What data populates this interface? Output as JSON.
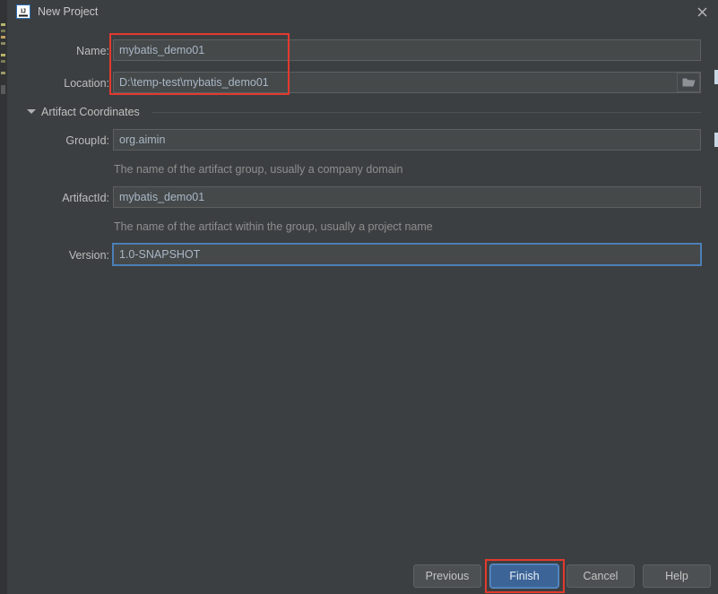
{
  "window": {
    "title": "New Project",
    "app_icon": "intellij-idea-icon",
    "close_icon": "close-icon"
  },
  "form": {
    "name": {
      "label": "Name:",
      "value": "mybatis_demo01"
    },
    "location": {
      "label": "Location:",
      "value": "D:\\temp-test\\mybatis_demo01",
      "browse_icon": "folder-icon"
    }
  },
  "section": {
    "label": "Artifact Coordinates",
    "expanded": true,
    "toggle_icon": "chevron-down-icon"
  },
  "artifact": {
    "group_id": {
      "label": "GroupId:",
      "value": "org.aimin",
      "hint": "The name of the artifact group, usually a company domain"
    },
    "artifact_id": {
      "label": "ArtifactId:",
      "value": "mybatis_demo01",
      "hint": "The name of the artifact within the group, usually a project name"
    },
    "version": {
      "label": "Version:",
      "value": "1.0-SNAPSHOT",
      "focused": true
    }
  },
  "buttons": {
    "previous": "Previous",
    "finish": "Finish",
    "cancel": "Cancel",
    "help": "Help"
  },
  "colors": {
    "dialog_background": "#3c3f41",
    "field_background": "#45494a",
    "field_border": "#5e6060",
    "text": "#bbbbbb",
    "hint_text": "#8e8e8e",
    "focus_blue": "#4b7fb8",
    "primary_button": "#3c6497",
    "annotation_red": "#e33a2e"
  }
}
